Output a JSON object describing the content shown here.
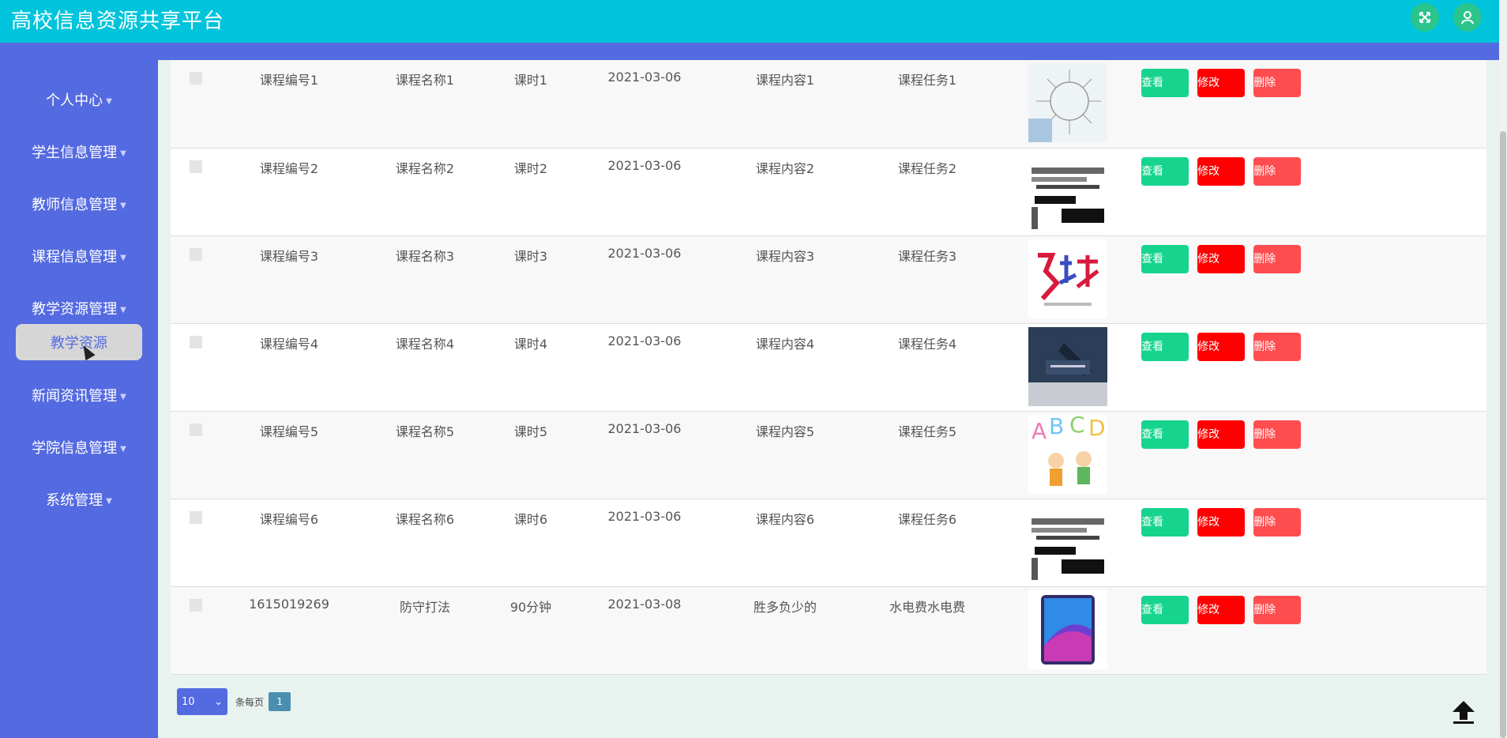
{
  "header": {
    "title": "高校信息资源共享平台"
  },
  "sidebar": {
    "items": [
      {
        "label": "个人中心"
      },
      {
        "label": "学生信息管理"
      },
      {
        "label": "教师信息管理"
      },
      {
        "label": "课程信息管理"
      },
      {
        "label": "教学资源管理"
      },
      {
        "label": "新闻资讯管理"
      },
      {
        "label": "学院信息管理"
      },
      {
        "label": "系统管理"
      }
    ],
    "active_submenu": "教学资源"
  },
  "actions": {
    "view": "查看",
    "edit": "修改",
    "delete": "删除"
  },
  "rows": [
    {
      "code": "课程编号1",
      "name": "课程名称1",
      "hours": "课时1",
      "date": "2021-03-06",
      "content": "课程内容1",
      "task": "课程任务1",
      "image_icon": "business-training-image"
    },
    {
      "code": "课程编号2",
      "name": "课程名称2",
      "hours": "课时2",
      "date": "2021-03-06",
      "content": "课程内容2",
      "task": "课程任务2",
      "image_icon": "vocabulary-words-image"
    },
    {
      "code": "课程编号3",
      "name": "课程名称3",
      "hours": "课时3",
      "date": "2021-03-06",
      "content": "课程内容3",
      "task": "课程任务3",
      "image_icon": "fitness-poster-image"
    },
    {
      "code": "课程编号4",
      "name": "课程名称4",
      "hours": "课时4",
      "date": "2021-03-06",
      "content": "课程内容4",
      "task": "课程任务4",
      "image_icon": "businessman-image"
    },
    {
      "code": "课程编号5",
      "name": "课程名称5",
      "hours": "课时5",
      "date": "2021-03-06",
      "content": "课程内容5",
      "task": "课程任务5",
      "image_icon": "abcd-kids-image"
    },
    {
      "code": "课程编号6",
      "name": "课程名称6",
      "hours": "课时6",
      "date": "2021-03-06",
      "content": "课程内容6",
      "task": "课程任务6",
      "image_icon": "vocabulary-words-image"
    },
    {
      "code": "1615019269",
      "name": "防守打法",
      "hours": "90分钟",
      "date": "2021-03-08",
      "content": "胜多负少的",
      "task": "水电费水电费",
      "image_icon": "phone-image"
    }
  ],
  "pagination": {
    "page_size": "10",
    "per_page_label": "条每页",
    "current_page": "1"
  },
  "colors": {
    "header": "#00c4db",
    "sidebar": "#546ae0",
    "view": "#16d48e",
    "edit": "#ff0000",
    "delete": "#ff4d4f"
  }
}
